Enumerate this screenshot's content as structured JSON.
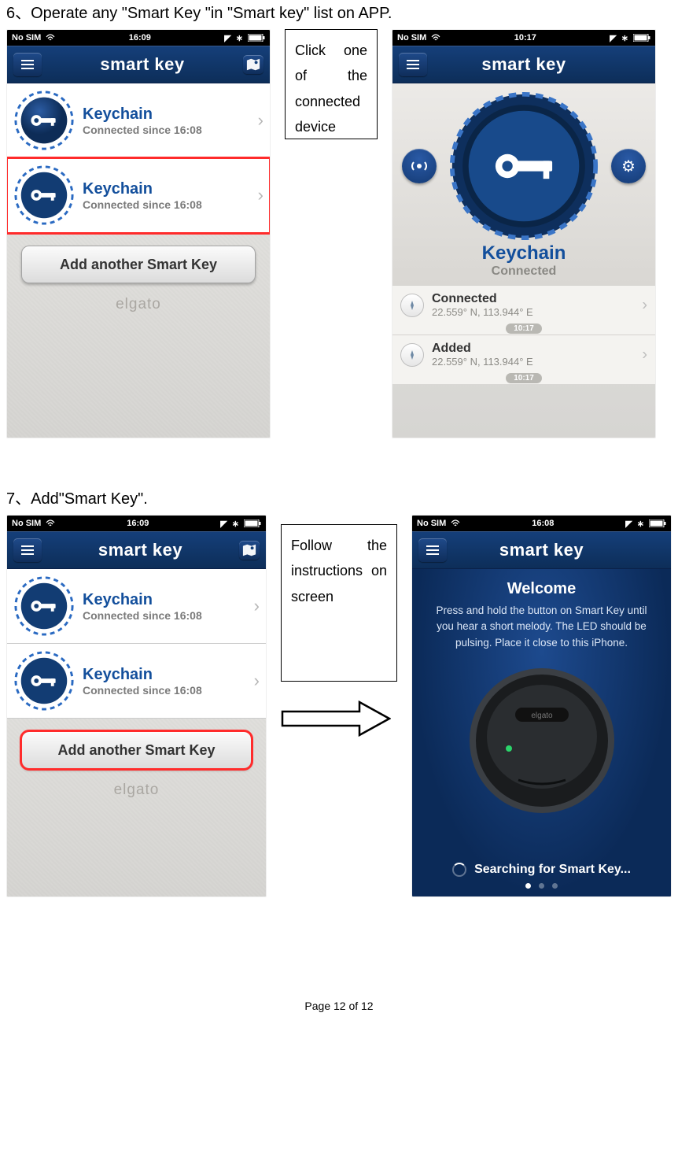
{
  "doc": {
    "step6": "6、Operate any \"Smart Key \"in \"Smart key\" list on APP.",
    "step7": "7、Add\"Smart Key\".",
    "callout_a": "Click one\nof the\nconnected\ndevice",
    "callout_b": "Follow the\ninstructions on\nscreen",
    "page_footer": "Page 12 of 12"
  },
  "common": {
    "app_title_a": "smart",
    "app_title_b": "key",
    "brand": "elgato",
    "chevron": "›",
    "gear": "⚙"
  },
  "statusbar": {
    "carrier": "No SIM",
    "wifi": "✶",
    "loc": "➤",
    "bt": "✱",
    "batt": "▮▮"
  },
  "screen1": {
    "time": "16:09",
    "items": [
      {
        "title": "Keychain",
        "sub": "Connected since 16:08"
      },
      {
        "title": "Keychain",
        "sub": "Connected since 16:08"
      }
    ],
    "add_label": "Add another Smart Key"
  },
  "screen2": {
    "time": "10:17",
    "name": "Keychain",
    "status": "Connected",
    "history": [
      {
        "title": "Connected",
        "sub": "22.559° N, 113.944° E",
        "time": "10:17"
      },
      {
        "title": "Added",
        "sub": "22.559° N, 113.944° E",
        "time": "10:17"
      }
    ]
  },
  "screen3": {
    "time": "16:09",
    "items": [
      {
        "title": "Keychain",
        "sub": "Connected since 16:08"
      },
      {
        "title": "Keychain",
        "sub": "Connected since 16:08"
      }
    ],
    "add_label": "Add another Smart Key"
  },
  "screen4": {
    "time": "16:08",
    "welcome_title": "Welcome",
    "welcome_body": "Press and hold the button on Smart Key until you hear a short melody.\nThe LED should be pulsing.\nPlace it close to this iPhone.",
    "searching": "Searching for Smart Key..."
  }
}
